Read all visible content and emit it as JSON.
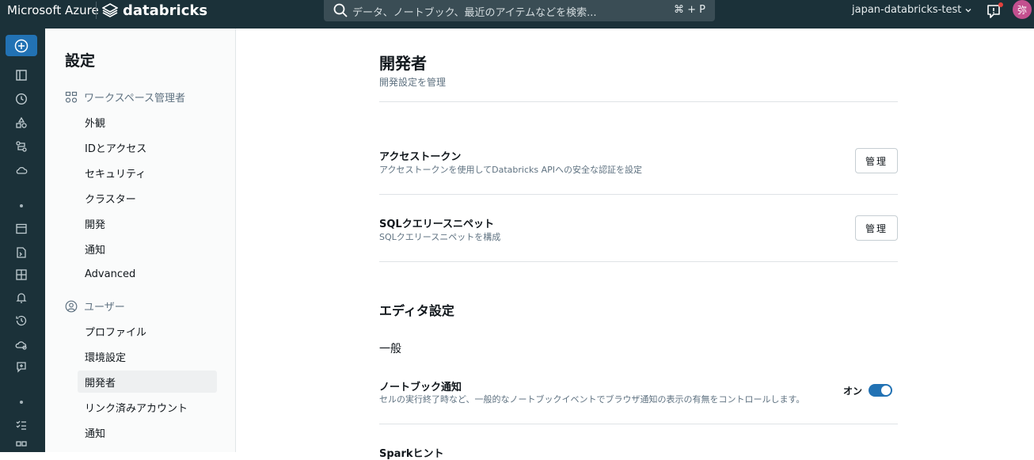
{
  "topbar": {
    "brand_azure": "Microsoft Azure",
    "brand_databricks": "databricks",
    "search_placeholder": "データ、ノートブック、最近のアイテムなどを検索...",
    "search_shortcut": "⌘ + P",
    "workspace": "japan-databricks-test",
    "avatar_initial": "弥"
  },
  "rail": {
    "icons": [
      "plus-icon",
      "workspace-icon",
      "recents-icon",
      "catalog-icon",
      "workflows-icon",
      "compute-icon",
      "sql-editor-icon",
      "queries-icon",
      "dashboards-icon",
      "alerts-icon",
      "query-history-icon",
      "sql-warehouses-icon",
      "experiments-icon",
      "features-icon",
      "models-icon"
    ]
  },
  "sidebar": {
    "title": "設定",
    "groups": [
      {
        "label": "ワークスペース管理者",
        "icon": "admin-icon",
        "items": [
          "外観",
          "IDとアクセス",
          "セキュリティ",
          "クラスター",
          "開発",
          "通知",
          "Advanced"
        ]
      },
      {
        "label": "ユーザー",
        "icon": "user-icon",
        "items": [
          "プロファイル",
          "環境設定",
          "開発者",
          "リンク済みアカウント",
          "通知"
        ]
      }
    ],
    "active_item": "開発者"
  },
  "main": {
    "title": "開発者",
    "subtitle": "開発設定を管理",
    "rows": [
      {
        "title": "アクセストークン",
        "desc": "アクセストークンを使用してDatabricks APIへの安全な認証を設定",
        "button": "管理"
      },
      {
        "title": "SQLクエリースニペット",
        "desc": "SQLクエリースニペットを構成",
        "button": "管理"
      }
    ],
    "editor_section": "エディタ設定",
    "general_heading": "一般",
    "notebook_notify": {
      "title": "ノートブック通知",
      "desc": "セルの実行終了時など、一般的なノートブックイベントでブラウザ通知の表示の有無をコントロールします。",
      "state_label": "オン",
      "enabled": true
    },
    "next_row_title": "Sparkヒント"
  },
  "colors": {
    "topbar": "#1b3139",
    "accent": "#2272b4",
    "avatar": "#c3508f"
  }
}
